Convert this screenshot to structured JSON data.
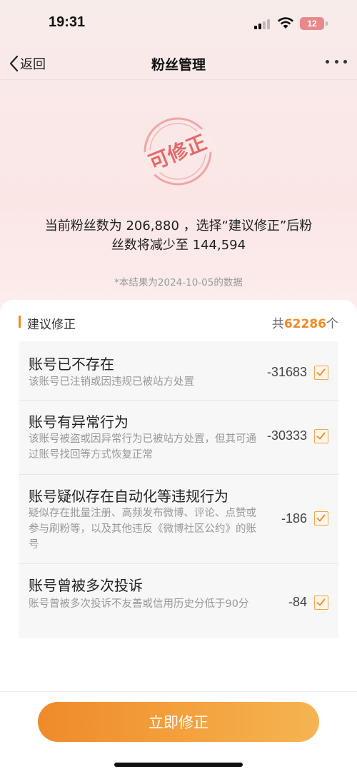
{
  "status_bar": {
    "time": "19:31",
    "battery": "12"
  },
  "nav": {
    "back_label": "返回",
    "title": "粉丝管理"
  },
  "stamp": {
    "text": "可修正"
  },
  "summary": {
    "line1": "当前粉丝数为 206,880 ，选择“建议修正”后粉",
    "line2": "丝数将减少至 144,594",
    "note": "*本结果为2024-10-05的数据"
  },
  "section": {
    "title": "建议修正",
    "count_prefix": "共",
    "count": "62286",
    "count_suffix": "个"
  },
  "items": [
    {
      "title": "账号已不存在",
      "desc": "该账号已注销或因违规已被站方处置",
      "value": "-31683",
      "checked": true
    },
    {
      "title": "账号有异常行为",
      "desc": "该账号被盗或因异常行为已被站方处置，但其可通过账号找回等方式恢复正常",
      "value": "-30333",
      "checked": true
    },
    {
      "title": "账号疑似存在自动化等违规行为",
      "desc": "疑似存在批量注册、高频发布微博、评论、点赞或参与刷粉等，以及其他违反《微博社区公约》的账号",
      "value": "-186",
      "checked": true
    },
    {
      "title": "账号曾被多次投诉",
      "desc": "账号曾被多次投诉不友善或信用历史分低于90分",
      "value": "-84",
      "checked": true
    }
  ],
  "button": {
    "label": "立即修正"
  },
  "colors": {
    "accent": "#f08a24",
    "stamp": "#e46a6a"
  },
  "icons": [
    "signal-icon",
    "wifi-icon",
    "battery-icon",
    "chevron-left-icon",
    "more-icon",
    "checkbox-checked-icon"
  ]
}
